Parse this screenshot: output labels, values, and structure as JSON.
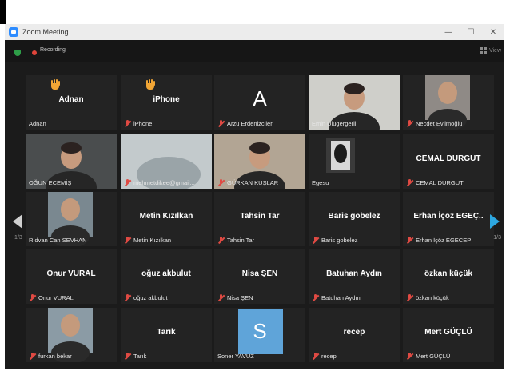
{
  "window": {
    "title": "Zoom Meeting"
  },
  "titlebar": {
    "minimize": "—",
    "maximize": "☐",
    "close": "✕"
  },
  "status": {
    "recording": "Recording",
    "view": "View"
  },
  "nav": {
    "page_left": "1/3",
    "page_right": "1/3"
  },
  "colors": {
    "active_border": "#b6d839",
    "muted": "#e04a43",
    "hand": "#f0a535",
    "nav_arrow": "#2da7e0",
    "avatar_s": "#5fa4d9"
  },
  "participants": [
    {
      "name": "Adnan",
      "label": "Adnan",
      "hand": true,
      "muted": false
    },
    {
      "name": "iPhone",
      "label": "iPhone",
      "hand": true,
      "muted": true
    },
    {
      "initial": "A",
      "label": "Arzu Erdenizciler",
      "muted": true
    },
    {
      "label": "Emin Ulugergerli",
      "video": "face-light",
      "active": true
    },
    {
      "label": "Necdet Evlimoğlu",
      "video": "face-pip",
      "muted": true
    },
    {
      "label": "OĞUN ECEMİŞ",
      "video": "face-dim"
    },
    {
      "label": "mehmetdikee@gmail...",
      "video": "blur",
      "muted": true
    },
    {
      "label": "GÜRKAN KUŞLAR",
      "video": "face-room",
      "muted": true
    },
    {
      "label": "Egesu",
      "video": "silhouette"
    },
    {
      "name": "CEMAL DURGUT",
      "label": "CEMAL DURGUT",
      "muted": true
    },
    {
      "label": "Rıdvan Can SEVHAN",
      "video": "face-pip2"
    },
    {
      "name": "Metin Kızılkan",
      "label": "Metin Kızılkan",
      "muted": true
    },
    {
      "name": "Tahsin Tar",
      "label": "Tahsin Tar",
      "muted": true
    },
    {
      "name": "Baris gobelez",
      "label": "Baris gobelez",
      "muted": true
    },
    {
      "name": "Erhan İçöz EGEÇ..",
      "label": "Erhan İçöz EGECEP",
      "muted": true
    },
    {
      "name": "Onur VURAL",
      "label": "Onur VURAL",
      "muted": true
    },
    {
      "name": "oğuz akbulut",
      "label": "oğuz akbulut",
      "muted": true
    },
    {
      "name": "Nisa ŞEN",
      "label": "Nisa ŞEN",
      "muted": true
    },
    {
      "name": "Batuhan Aydın",
      "label": "Batuhan Aydın",
      "muted": true
    },
    {
      "name": "özkan küçük",
      "label": "özkan küçük",
      "muted": true
    },
    {
      "label": "furkan bekar",
      "video": "face-pip3",
      "muted": true
    },
    {
      "name": "Tarık",
      "label": "Tarık",
      "muted": true
    },
    {
      "initial": "S",
      "label": "Soner YAVUZ",
      "avatar": true
    },
    {
      "name": "recep",
      "label": "recep",
      "muted": true
    },
    {
      "name": "Mert GÜÇLÜ",
      "label": "Mert GÜÇLÜ",
      "muted": true
    }
  ]
}
